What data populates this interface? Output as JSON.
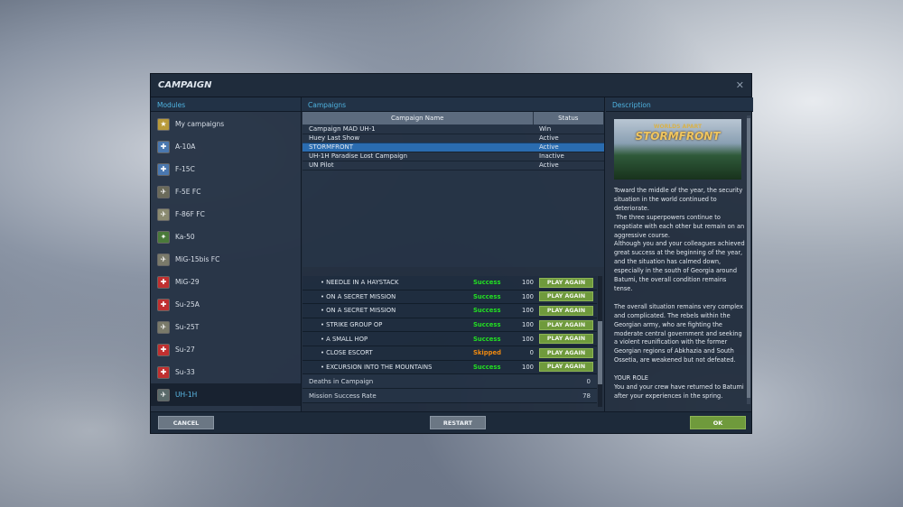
{
  "dialog": {
    "title": "CAMPAIGN"
  },
  "headers": {
    "modules": "Modules",
    "campaigns": "Campaigns",
    "description": "Description"
  },
  "modules": [
    {
      "label": "My campaigns",
      "selected": false
    },
    {
      "label": "A-10A"
    },
    {
      "label": "F-15C"
    },
    {
      "label": "F-5E FC"
    },
    {
      "label": "F-86F FC"
    },
    {
      "label": "Ka-50"
    },
    {
      "label": "MiG-15bis FC"
    },
    {
      "label": "MiG-29"
    },
    {
      "label": "Su-25A"
    },
    {
      "label": "Su-25T"
    },
    {
      "label": "Su-27"
    },
    {
      "label": "Su-33"
    },
    {
      "label": "UH-1H",
      "selected": true
    }
  ],
  "campaign_table": {
    "columns": [
      "Campaign Name",
      "Status"
    ],
    "rows": [
      [
        "Campaign MAD UH-1",
        "Win"
      ],
      [
        "Huey Last Show",
        "Active"
      ],
      [
        "STORMFRONT",
        "Active"
      ],
      [
        "UH-1H Paradise Lost Campaign",
        "Inactive"
      ],
      [
        "UN Pilot",
        "Active"
      ]
    ],
    "selected": 2
  },
  "missions": [
    {
      "name": "NEEDLE IN A HAYSTACK",
      "status": "Success",
      "score": "100"
    },
    {
      "name": "ON A SECRET MISSION",
      "status": "Success",
      "score": "100"
    },
    {
      "name": "ON A SECRET MISSION",
      "status": "Success",
      "score": "100"
    },
    {
      "name": "STRIKE GROUP OP",
      "status": "Success",
      "score": "100"
    },
    {
      "name": "A SMALL HOP",
      "status": "Success",
      "score": "100"
    },
    {
      "name": "CLOSE ESCORT",
      "status": "Skipped",
      "score": "0"
    },
    {
      "name": "EXCURSION INTO THE MOUNTAINS",
      "status": "Success",
      "score": "100"
    }
  ],
  "play_again_label": "PLAY AGAIN",
  "stats": [
    {
      "label": "Deaths in Campaign",
      "value": "0"
    },
    {
      "label": "Mission Success Rate",
      "value": "78"
    }
  ],
  "description": {
    "image_title_top": "WORLDS APART",
    "image_title": "STORMFRONT",
    "text": "Toward the middle of the year, the security situation in the world continued to deteriorate.\n The three superpowers continue to negotiate with each other but remain on an aggressive course.\nAlthough you and your colleagues achieved great success at the beginning of the year, and the situation has calmed down, especially in the south of Georgia around Batumi, the overall condition remains tense.\n\nThe overall situation remains very complex and complicated. The rebels within the Georgian army, who are fighting the moderate central government and seeking a violent reunification with the former Georgian regions of Abkhazia and South Ossetia, are weakened but not defeated.\n\nYOUR ROLE\nYou and your crew have returned to Batumi after your experiences in the spring.\n\nThe situation is calm, and patrol flights are the central part of your program. Surveillance"
  },
  "buttons": {
    "cancel": "CANCEL",
    "restart": "RESTART",
    "ok": "OK"
  },
  "colors": {
    "success": "#22e022",
    "skipped": "#f08a10",
    "accent": "#4fb3e0"
  }
}
